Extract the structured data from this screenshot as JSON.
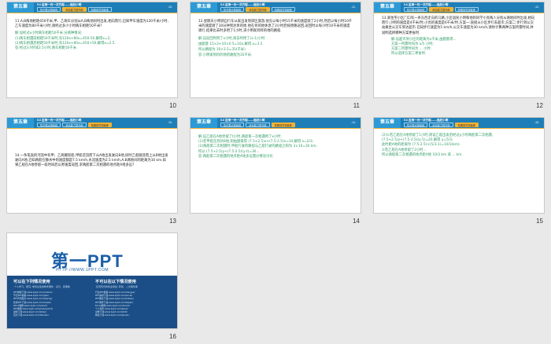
{
  "header": {
    "chapter": "第五章",
    "title": "5.6  应用一元一次方程——追赶小明",
    "tabs": [
      "知识要点基础练",
      "综合能力提升练",
      "拓展探究突破练"
    ]
  },
  "slides": [
    {
      "num": "10",
      "page": "-10-",
      "active_tab": 1,
      "text": "11.A,B两地相距450千米,甲、乙两车分别从A,B两地同时出发,相向而行,已知甲车速度为120千米/小时,乙车速度为80千米/小时,则经过多少小时两车相距50千米?",
      "answer": "解:设经过x小时两车相距50千米.分两种情况:\n(1)两车相遇前相距50千米时,有120x+80x=450-50,解得x=2;\n(2)两车相遇后相距50千米时,有120x+80x=450+50,解得x=2.5.\n答:经过2小时或2.5小时,两车相距50千米."
    },
    {
      "num": "11",
      "page": "-11-",
      "active_tab": 1,
      "text": "12.星期天小明骑自行车从家出发到郊区旅游,他先以每小时15千米的速度骑了2小时,然后以每小时10千米的速度骑了30分钟到达目的地.他在目的地休息了2小时后按原路返回,返回时以每小时10千米的速度骑行,结果比去时多用了1小时,求小明家到目的地的路程.",
      "answer": "解:设返回时用了t小时,由题意得...",
      "formulas": [
        "解:设返回时用了x小时,则去时用了(x-1)小时",
        "由题意 15×2+10×0.5=10x,解得 x=3.5",
        "所以路程为 10×3.5=35(千米)",
        "答:小明家到目的地的路程为35千米."
      ]
    },
    {
      "num": "12",
      "page": "-12-",
      "active_tab": 1,
      "text": "13.某住宅小区门口有一条东西走向的马路,小区居民小明和他的同学小亮两人分别从两地同时出发,相向而行,小明的速度是4千米/时,小亮的速度是6千米/时.方案一:直接从小区步行去超市;方案二:步行到公交站乘坐公交车到达超市.已知步行速度为5 km/h,公交车速度为30 km/h,请你计算两种方案所需时间,并说明选择哪种方案更省时.",
      "answer": "解:设超市到小区的距离为x千米,由题意得...\n方案一所需时间为 x/5 小时;\n方案二所需时间为 ... 小时.\n所以选择方案二更省时."
    },
    {
      "num": "13",
      "page": "-13-",
      "active_tab": 2,
      "text": "14.一条笔直的河流中有甲、乙两艘轮船,甲船逆流而下从A地出发驶向B地,同时乙船顺流而上从B地出发驶向A地,已知两船在静水中的速度都是7.5 km/h,水流速度为2.5 km/h,A,B两地间的距离为10 km.如果乙船在A地停留一段时间后以原速度返回,求两船第二次相遇的地点距A地多远?"
    },
    {
      "num": "14",
      "page": "-14-",
      "active_tab": 2,
      "answer": "解:设乙船在A地停留了t小时,两船第一次相遇用了x小时.\n(1)若甲船先到达B地,则由题意得 (7.5+2.5)x+(7.5-2.5)x=10,解得 x=2/3;\n(2)两船第二次相遇时,甲船行驶的路程与乙船行驶的路程之和为 3×10=30 km,\n所以 (7.5+2.5)y+(7.5-2.5)(y-t)=30...\n答:两船第二次相遇的地点距A地多远需分情况讨论."
    },
    {
      "num": "15",
      "page": "-15-",
      "active_tab": 2,
      "answer": "(2)①若乙船在A地停留了1小时,则设乙船出发后经过y小时两船第二次相遇,\n(7.5+2.5)y+(7.5-2.5)(y-1)=20,解得 y=5/3;\n此时距A地的距离为 (7.5-2.5)×(5/3-1)=10/3(km).\n②若乙船在A地停留了2小时...\n所以两船第二次相遇的地点距A地 10/3 km 或 ... km."
    }
  ],
  "logo_slide": {
    "num": "16",
    "brand": "第一PPT",
    "url": "HTTP://WWW.1PPT.COM",
    "left_head": "可以在下列情况使用",
    "left_sub": "·个人学习、研究;·非商业性的教学课件、演示、授课等",
    "left_items": [
      "PPT模板下载:www.1ppt.com/moban/",
      "节日PPT模板:www.1ppt.com/jieri/",
      "PPT背景图片:www.1ppt.com/beijing/",
      "优秀PPT下载:www.1ppt.com/xiazai/",
      "Word教程:www.1ppt.com/word/",
      "PPT教程:www.1ppt.com/powerpoint/",
      "资料下载:www.1ppt.com/ziliao/",
      "范文下载:www.1ppt.com/fanwen/"
    ],
    "right_head": "不可以在以下情况使用",
    "right_sub": "·任何形式的商业用途;·转载、二次销售等",
    "right_items": [
      "行业PPT模板:www.1ppt.com/hangye/",
      "PPT素材下载:www.1ppt.com/sucai/",
      "PPT图表下载:www.1ppt.com/tubiao/",
      "PPT课件下载:www.1ppt.com/kejian/",
      "Excel教程:www.1ppt.com/excel/",
      "个人简历:www.1ppt.com/jianli/",
      "试卷下载:www.1ppt.com/shiti/",
      "教案下载:www.1ppt.com/jiaoan/"
    ]
  }
}
